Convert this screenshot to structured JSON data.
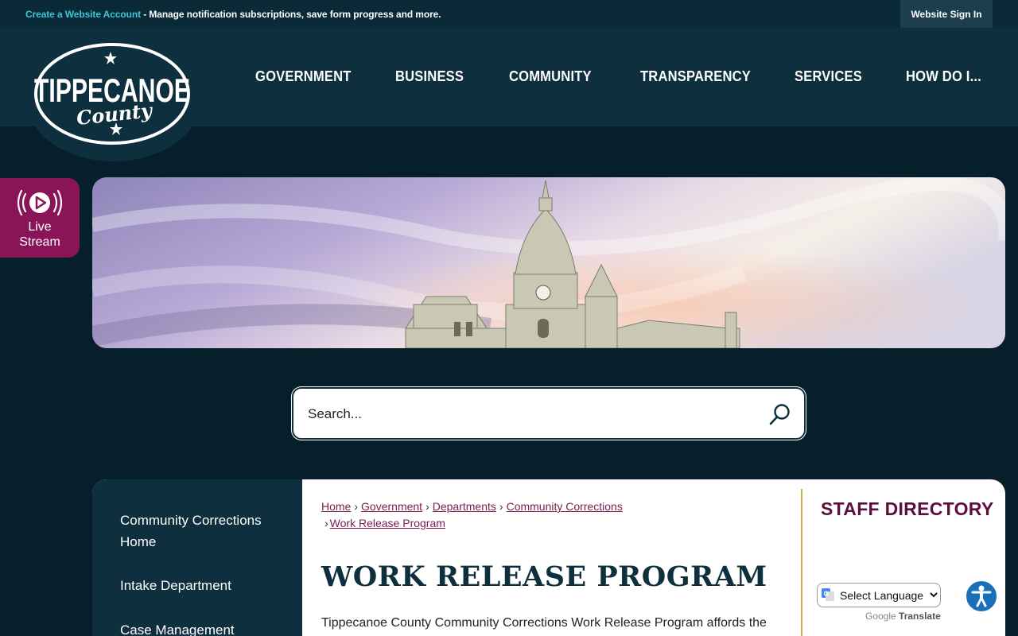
{
  "topbar": {
    "create_account_link": "Create a Website Account",
    "message": " - Manage notification subscriptions, save form progress and more.",
    "sign_in_label": "Website Sign In"
  },
  "logo": {
    "line1": "TIPPECANOE",
    "line2": "County"
  },
  "nav": {
    "items": [
      "GOVERNMENT",
      "BUSINESS",
      "COMMUNITY",
      "TRANSPARENCY",
      "SERVICES",
      "HOW DO I..."
    ]
  },
  "live_stream": {
    "label_line1": "Live",
    "label_line2": "Stream"
  },
  "search": {
    "placeholder": "Search..."
  },
  "sidenav": {
    "items": [
      "Community Corrections Home",
      "Intake Department",
      "Case Management"
    ]
  },
  "breadcrumb": {
    "items": [
      "Home",
      "Government",
      "Departments",
      "Community Corrections",
      "Work Release Program"
    ]
  },
  "page": {
    "title": "WORK RELEASE PROGRAM",
    "intro": "Tippecanoe County Community Corrections Work Release Program affords the"
  },
  "sidebar": {
    "staff_directory": "STAFF DIRECTORY"
  },
  "translate": {
    "select_label": "Select Language",
    "powered_google": "Google",
    "powered_translate": "Translate"
  },
  "colors": {
    "background": "#071f2b",
    "header": "#0e2f3e",
    "accent_teal": "#3ec6d6",
    "live_stream": "#8a1458",
    "link": "#7a1c4f",
    "staff_heading": "#5c0f3b",
    "divider_gold": "#c9a94a",
    "accessibility_blue": "#1a70b8"
  }
}
